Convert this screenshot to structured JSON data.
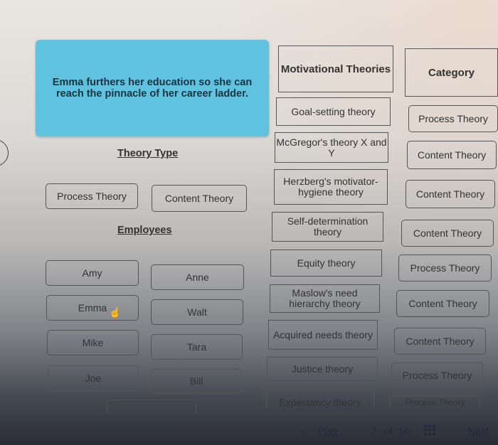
{
  "prompt": "Emma furthers her education so she can reach the pinnacle of her career ladder.",
  "theory_type": {
    "label": "Theory Type",
    "options": [
      "Process Theory",
      "Content Theory"
    ]
  },
  "employees": {
    "label": "Employees",
    "names": [
      "Amy",
      "Anne",
      "Emma",
      "Walt",
      "Mike",
      "Tara",
      "Joe",
      "Bill"
    ]
  },
  "table": {
    "headers": [
      "Motivational Theories",
      "Category"
    ],
    "rows": [
      {
        "theory": "Goal-setting theory",
        "category": "Process Theory"
      },
      {
        "theory": "McGregor's theory X and Y",
        "category": "Content Theory"
      },
      {
        "theory": "Herzberg's motivator-hygiene theory",
        "category": "Content Theory"
      },
      {
        "theory": "Self-determination theory",
        "category": "Content Theory"
      },
      {
        "theory": "Equity theory",
        "category": "Process Theory"
      },
      {
        "theory": "Maslow's need hierarchy theory",
        "category": "Content Theory"
      },
      {
        "theory": "Acquired needs theory",
        "category": "Content Theory"
      },
      {
        "theory": "Justice theory",
        "category": "Process Theory"
      },
      {
        "theory": "Expectancy theory",
        "category": "Process Theory"
      }
    ]
  },
  "pagination": {
    "prev_label": "Prev",
    "prev_icon": "chevron-left-icon",
    "current": "7",
    "of_label": "of",
    "total": "16",
    "grid_icon": "grid-icon",
    "next_label": "Next"
  }
}
